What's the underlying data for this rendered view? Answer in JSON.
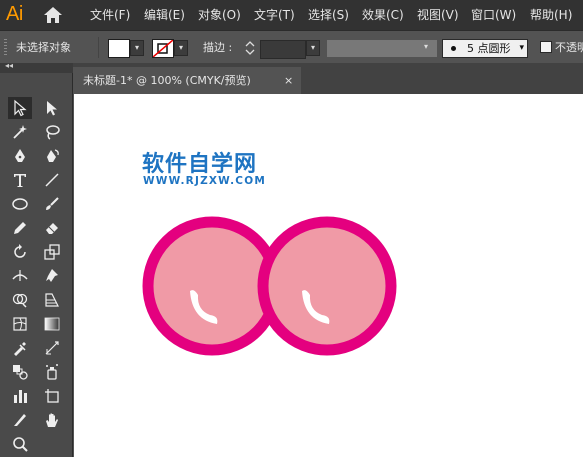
{
  "app": {
    "logo_text": "Ai"
  },
  "menu": {
    "items": [
      {
        "label": "文件(F)"
      },
      {
        "label": "编辑(E)"
      },
      {
        "label": "对象(O)"
      },
      {
        "label": "文字(T)"
      },
      {
        "label": "选择(S)"
      },
      {
        "label": "效果(C)"
      },
      {
        "label": "视图(V)"
      },
      {
        "label": "窗口(W)"
      },
      {
        "label": "帮助(H)"
      }
    ]
  },
  "control_bar": {
    "selection_status": "未选择对象",
    "stroke_label": "描边 :",
    "brush_value": "5 点圆形",
    "opacity_label": "不透明"
  },
  "document_tab": {
    "title": "未标题-1* @ 100% (CMYK/预览)",
    "close_glyph": "×"
  },
  "toolbar": {
    "collapse_glyph": "◂◂",
    "tools": [
      {
        "name": "selection-tool-icon"
      },
      {
        "name": "direct-selection-tool-icon"
      },
      {
        "name": "magic-wand-tool-icon"
      },
      {
        "name": "lasso-tool-icon"
      },
      {
        "name": "pen-tool-icon"
      },
      {
        "name": "curvature-tool-icon"
      },
      {
        "name": "type-tool-icon"
      },
      {
        "name": "line-segment-tool-icon"
      },
      {
        "name": "ellipse-tool-icon"
      },
      {
        "name": "paintbrush-tool-icon"
      },
      {
        "name": "pencil-tool-icon"
      },
      {
        "name": "eraser-tool-icon"
      },
      {
        "name": "rotate-tool-icon"
      },
      {
        "name": "scale-tool-icon"
      },
      {
        "name": "width-tool-icon"
      },
      {
        "name": "puppet-warp-tool-icon"
      },
      {
        "name": "shape-builder-tool-icon"
      },
      {
        "name": "perspective-grid-tool-icon"
      },
      {
        "name": "mesh-tool-icon"
      },
      {
        "name": "gradient-tool-icon"
      },
      {
        "name": "eyedropper-tool-icon"
      },
      {
        "name": "measure-tool-icon"
      },
      {
        "name": "blend-tool-icon"
      },
      {
        "name": "symbol-sprayer-tool-icon"
      },
      {
        "name": "column-graph-tool-icon"
      },
      {
        "name": "artboard-tool-icon"
      },
      {
        "name": "slice-tool-icon"
      },
      {
        "name": "hand-tool-icon"
      },
      {
        "name": "zoom-tool-icon"
      }
    ]
  },
  "artwork": {
    "watermark_title": "软件自学网",
    "watermark_url": "WWW.RJZXW.COM",
    "circle_fill": "#f09aa6",
    "circle_stroke": "#e4007f",
    "highlight": "#ffffff"
  },
  "colors": {
    "menubar_bg": "#323232",
    "panel_bg": "#535353",
    "logo": "#ff9a00",
    "watermark": "#1e74c2"
  }
}
